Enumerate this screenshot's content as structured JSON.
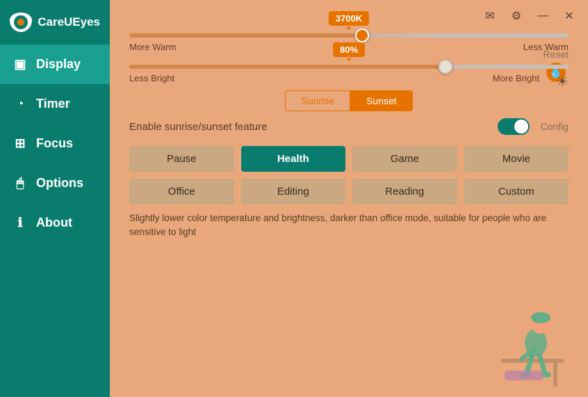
{
  "app": {
    "title": "CareUEyes"
  },
  "sidebar": {
    "items": [
      {
        "id": "display",
        "label": "Display",
        "icon": "⊡",
        "active": true
      },
      {
        "id": "timer",
        "label": "Timer",
        "icon": "🕐",
        "active": false
      },
      {
        "id": "focus",
        "label": "Focus",
        "icon": "⊞",
        "active": false
      },
      {
        "id": "options",
        "label": "Options",
        "icon": "🖱",
        "active": false
      },
      {
        "id": "about",
        "label": "About",
        "icon": "ℹ",
        "active": false
      }
    ]
  },
  "titlebar": {
    "email_icon": "✉",
    "settings_icon": "⚙",
    "minimize_icon": "—",
    "close_icon": "✕"
  },
  "display": {
    "reset_label": "Reset",
    "temperature": {
      "value": "3700K",
      "more_warm": "More Warm",
      "less_warm": "Less Warm",
      "fill_pct": 53,
      "thumb_pct": 53
    },
    "brightness": {
      "value": "80%",
      "less_bright": "Less Bright",
      "more_bright": "More Bright",
      "fill_pct": 72,
      "thumb_pct": 72
    },
    "sunrise_label": "Sunrise",
    "sunset_label": "Sunset",
    "active_tab": "Sunset",
    "enable_label": "Enable sunrise/sunset feature",
    "config_label": "Config",
    "modes": [
      {
        "id": "pause",
        "label": "Pause",
        "active": false
      },
      {
        "id": "health",
        "label": "Health",
        "active": true
      },
      {
        "id": "game",
        "label": "Game",
        "active": false
      },
      {
        "id": "movie",
        "label": "Movie",
        "active": false
      },
      {
        "id": "office",
        "label": "Office",
        "active": false
      },
      {
        "id": "editing",
        "label": "Editing",
        "active": false
      },
      {
        "id": "reading",
        "label": "Reading",
        "active": false
      },
      {
        "id": "custom",
        "label": "Custom",
        "active": false
      }
    ],
    "description": "Slightly lower color temperature and brightness, darker than office mode,\nsuitable for people who are sensitive to light"
  }
}
